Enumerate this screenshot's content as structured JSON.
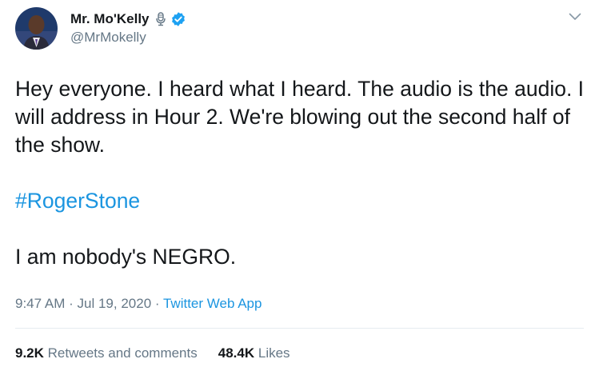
{
  "author": {
    "display_name": "Mr. Mo'Kelly",
    "handle": "@MrMokelly"
  },
  "tweet": {
    "paragraphs": [
      "Hey everyone.  I heard what I heard.  The audio is the audio.  I will address in Hour 2.  We're blowing out the second half of the show.",
      "#RogerStone",
      "I am nobody's NEGRO."
    ],
    "time": "9:47 AM",
    "date": "Jul 19, 2020",
    "sep": "·",
    "source": "Twitter Web App"
  },
  "stats": {
    "retweets_count": "9.2K",
    "retweets_label": "Retweets and comments",
    "likes_count": "48.4K",
    "likes_label": "Likes"
  },
  "colors": {
    "link": "#1b95e0",
    "verified": "#1da1f2",
    "secondary_text": "#657786"
  },
  "icons": [
    "microphone-icon",
    "verified-badge-icon",
    "chevron-down-icon"
  ]
}
